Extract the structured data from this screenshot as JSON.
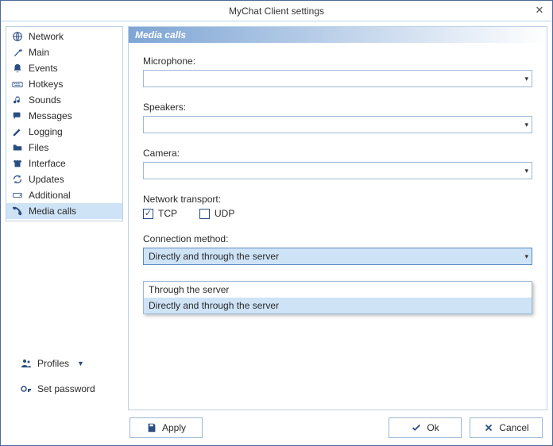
{
  "window": {
    "title": "MyChat Client settings"
  },
  "sidebar": {
    "items": [
      {
        "label": "Network"
      },
      {
        "label": "Main"
      },
      {
        "label": "Events"
      },
      {
        "label": "Hotkeys"
      },
      {
        "label": "Sounds"
      },
      {
        "label": "Messages"
      },
      {
        "label": "Logging"
      },
      {
        "label": "Files"
      },
      {
        "label": "Interface"
      },
      {
        "label": "Updates"
      },
      {
        "label": "Additional"
      },
      {
        "label": "Media calls"
      }
    ],
    "profiles_label": "Profiles",
    "set_password_label": "Set password"
  },
  "content": {
    "header": "Media calls",
    "microphone_label": "Microphone:",
    "microphone_value": "",
    "speakers_label": "Speakers:",
    "speakers_value": "",
    "camera_label": "Camera:",
    "camera_value": "",
    "network_transport_label": "Network transport:",
    "tcp_label": "TCP",
    "tcp_checked": true,
    "udp_label": "UDP",
    "udp_checked": false,
    "connection_method_label": "Connection method:",
    "connection_method_value": "Directly and through the server",
    "connection_method_options": [
      "Through the server",
      "Directly and through the server"
    ]
  },
  "footer": {
    "apply": "Apply",
    "ok": "Ok",
    "cancel": "Cancel"
  }
}
